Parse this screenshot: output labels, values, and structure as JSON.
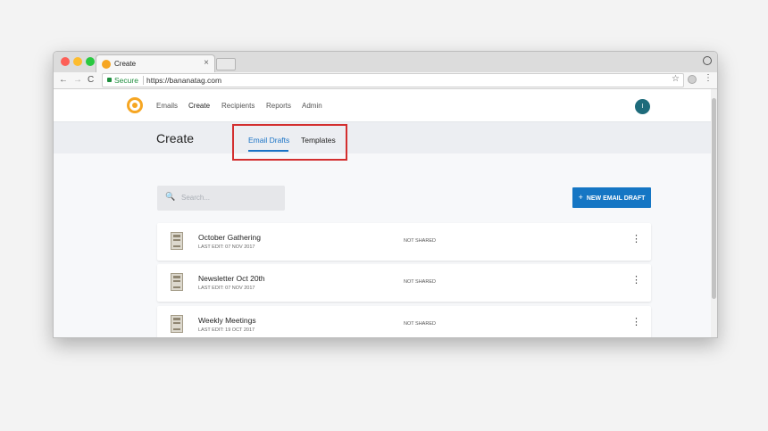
{
  "browser": {
    "tab_title": "Create",
    "tab_close": "×",
    "secure_label": "Secure",
    "url": "https://bananatag.com"
  },
  "app_nav": {
    "links": [
      "Emails",
      "Create",
      "Recipients",
      "Reports",
      "Admin"
    ],
    "active": "Create",
    "avatar_initial": "I"
  },
  "page": {
    "title": "Create",
    "tabs": [
      {
        "label": "Email Drafts",
        "active": true
      },
      {
        "label": "Templates",
        "active": false
      }
    ]
  },
  "search": {
    "placeholder": "Search..."
  },
  "new_draft_button": {
    "plus": "+",
    "label": "NEW EMAIL DRAFT"
  },
  "drafts": [
    {
      "name": "October Gathering",
      "last_edit": "LAST EDIT: 07 NOV 2017",
      "status": "NOT SHARED"
    },
    {
      "name": "Newsletter Oct 20th",
      "last_edit": "LAST EDIT: 07 NOV 2017",
      "status": "NOT SHARED"
    },
    {
      "name": "Weekly Meetings",
      "last_edit": "LAST EDIT: 19 OCT 2017",
      "status": "NOT SHARED"
    }
  ],
  "icons": {
    "back": "←",
    "forward": "→",
    "reload": "C",
    "star": "☆",
    "menu": "⋮",
    "search": "🔍",
    "more": "⋮"
  },
  "colors": {
    "accent": "#1576c4",
    "highlight": "#d32f2f",
    "brand": "#f6a623",
    "avatar": "#1e6b7b"
  }
}
